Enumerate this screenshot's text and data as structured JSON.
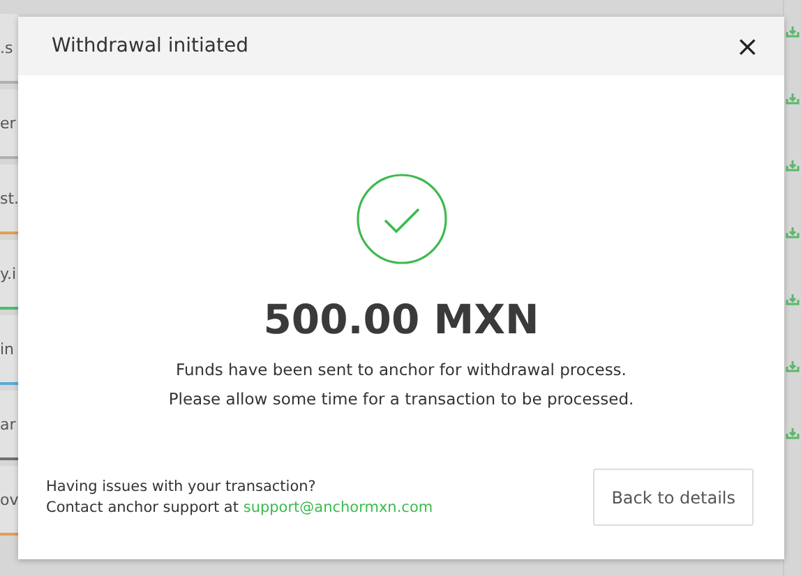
{
  "background_list": [
    {
      "label": ".s",
      "color": "#b0b0b0"
    },
    {
      "label": "er",
      "color": "#b0b0b0"
    },
    {
      "label": "st.",
      "color": "#e0a050"
    },
    {
      "label": "y.i",
      "color": "#4cbb6a"
    },
    {
      "label": "in",
      "color": "#5aa8d8"
    },
    {
      "label": "ar",
      "color": "#707070"
    },
    {
      "label": "ov",
      "color": "#e0a050"
    }
  ],
  "modal": {
    "title": "Withdrawal initiated",
    "close": "×",
    "amount": "500.00 MXN",
    "message": [
      "Funds have been sent to anchor for withdrawal process.",
      "Please allow some time for a transaction to be processed."
    ],
    "help_question": "Having issues with your transaction?",
    "help_contact": "Contact anchor support at",
    "support_email": "support@anchormxn.com",
    "button": "Back to details"
  }
}
